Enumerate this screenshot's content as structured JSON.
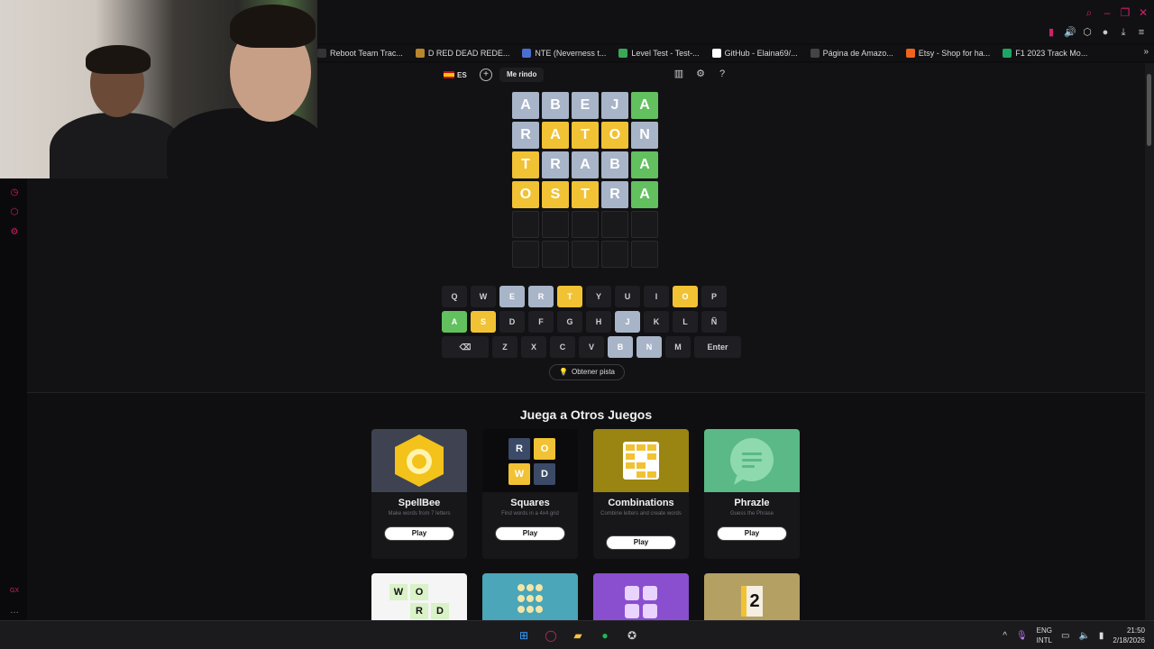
{
  "bookmarks": [
    {
      "label": "Reboot Team Trac...",
      "icon": "bookmark-icon",
      "color": "#333333"
    },
    {
      "label": "D RED DEAD REDE...",
      "icon": "rdr-icon",
      "color": "#b8862b"
    },
    {
      "label": "NTE (Neverness t...",
      "icon": "nte-icon",
      "color": "#4a6fd0"
    },
    {
      "label": "Level Test - Test-...",
      "icon": "check-icon",
      "color": "#3aa856"
    },
    {
      "label": "GitHub - Elaina69/...",
      "icon": "github-icon",
      "color": "#ffffff"
    },
    {
      "label": "Página de Amazo...",
      "icon": "amazon-icon",
      "color": "#444444"
    },
    {
      "label": "Etsy - Shop for ha...",
      "icon": "etsy-icon",
      "color": "#f1641e"
    },
    {
      "label": "F1 2023 Track Mo...",
      "icon": "drive-icon",
      "color": "#1fa463"
    }
  ],
  "header": {
    "lang_code": "ES",
    "give_up_label": "Me rindo"
  },
  "board": {
    "rows": [
      [
        {
          "l": "A",
          "s": "gray"
        },
        {
          "l": "B",
          "s": "gray"
        },
        {
          "l": "E",
          "s": "gray"
        },
        {
          "l": "J",
          "s": "gray"
        },
        {
          "l": "A",
          "s": "green"
        }
      ],
      [
        {
          "l": "R",
          "s": "gray"
        },
        {
          "l": "A",
          "s": "yellow"
        },
        {
          "l": "T",
          "s": "yellow"
        },
        {
          "l": "O",
          "s": "yellow"
        },
        {
          "l": "N",
          "s": "gray"
        }
      ],
      [
        {
          "l": "T",
          "s": "yellow"
        },
        {
          "l": "R",
          "s": "gray"
        },
        {
          "l": "A",
          "s": "gray"
        },
        {
          "l": "B",
          "s": "gray"
        },
        {
          "l": "A",
          "s": "green"
        }
      ],
      [
        {
          "l": "O",
          "s": "yellow"
        },
        {
          "l": "S",
          "s": "yellow"
        },
        {
          "l": "T",
          "s": "yellow"
        },
        {
          "l": "R",
          "s": "gray"
        },
        {
          "l": "A",
          "s": "green"
        }
      ],
      [
        {
          "l": "",
          "s": "empty"
        },
        {
          "l": "",
          "s": "empty"
        },
        {
          "l": "",
          "s": "empty"
        },
        {
          "l": "",
          "s": "empty"
        },
        {
          "l": "",
          "s": "empty"
        }
      ],
      [
        {
          "l": "",
          "s": "empty"
        },
        {
          "l": "",
          "s": "empty"
        },
        {
          "l": "",
          "s": "empty"
        },
        {
          "l": "",
          "s": "empty"
        },
        {
          "l": "",
          "s": "empty"
        }
      ]
    ]
  },
  "keyboard": {
    "rows": [
      [
        {
          "k": "Q",
          "s": ""
        },
        {
          "k": "W",
          "s": ""
        },
        {
          "k": "E",
          "s": "gray"
        },
        {
          "k": "R",
          "s": "gray"
        },
        {
          "k": "T",
          "s": "yellow"
        },
        {
          "k": "Y",
          "s": ""
        },
        {
          "k": "U",
          "s": ""
        },
        {
          "k": "I",
          "s": ""
        },
        {
          "k": "O",
          "s": "yellow"
        },
        {
          "k": "P",
          "s": ""
        }
      ],
      [
        {
          "k": "A",
          "s": "green"
        },
        {
          "k": "S",
          "s": "yellow"
        },
        {
          "k": "D",
          "s": ""
        },
        {
          "k": "F",
          "s": ""
        },
        {
          "k": "G",
          "s": ""
        },
        {
          "k": "H",
          "s": ""
        },
        {
          "k": "J",
          "s": "gray"
        },
        {
          "k": "K",
          "s": ""
        },
        {
          "k": "L",
          "s": ""
        },
        {
          "k": "Ñ",
          "s": ""
        }
      ],
      [
        {
          "k": "⌫",
          "s": "",
          "wide": true
        },
        {
          "k": "Z",
          "s": ""
        },
        {
          "k": "X",
          "s": ""
        },
        {
          "k": "C",
          "s": ""
        },
        {
          "k": "V",
          "s": ""
        },
        {
          "k": "B",
          "s": "gray"
        },
        {
          "k": "N",
          "s": "gray"
        },
        {
          "k": "M",
          "s": ""
        },
        {
          "k": "Enter",
          "s": "",
          "wide": true
        }
      ]
    ]
  },
  "hint_label": "Obtener pista",
  "other_games": {
    "title": "Juega a Otros Juegos",
    "cards": [
      {
        "name": "SpellBee",
        "sub": "Make words from 7 letters",
        "play": "Play",
        "bg": "#3e4251"
      },
      {
        "name": "Squares",
        "sub": "Find words in a 4x4 grid",
        "play": "Play",
        "bg": "#0b0b0d"
      },
      {
        "name": "Combinations",
        "sub": "Combine letters and create words",
        "play": "Play",
        "bg": "#9a8412"
      },
      {
        "name": "Phrazle",
        "sub": "Guess the Phrase",
        "play": "Play",
        "bg": "#5ab987"
      }
    ],
    "squares_letters": [
      "R",
      "O",
      "W",
      "D"
    ],
    "word_tile": [
      "W",
      "O",
      "R",
      "D"
    ],
    "number_tile": "2"
  },
  "taskbar": {
    "lang": "ENG",
    "layout": "INTL",
    "time": "21:50",
    "date": "2/18/2026"
  }
}
